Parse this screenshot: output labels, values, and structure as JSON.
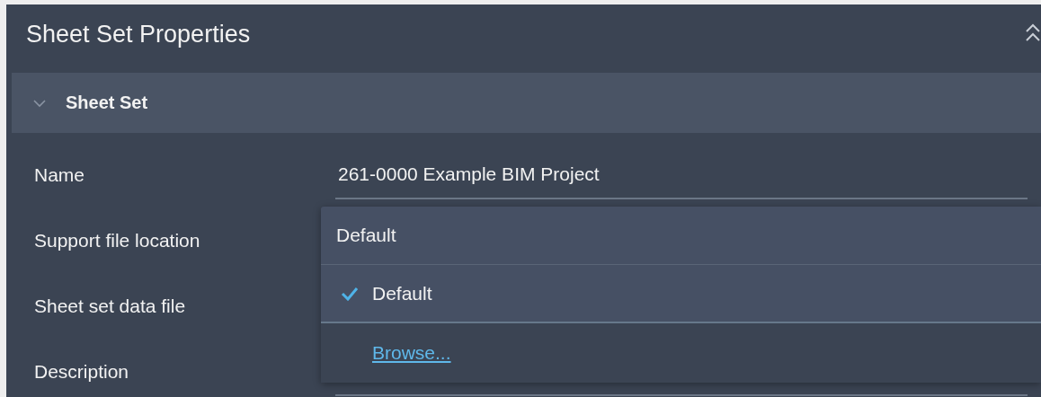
{
  "panel": {
    "title": "Sheet Set Properties"
  },
  "section": {
    "title": "Sheet Set",
    "expanded": true
  },
  "properties": [
    {
      "label": "Name",
      "value": "261-0000 Example BIM Project"
    },
    {
      "label": "Support file location",
      "field": false
    },
    {
      "label": "Sheet set data file",
      "field": false
    },
    {
      "label": "Description",
      "field": true
    }
  ],
  "dropdown": {
    "current": "Default",
    "options": [
      {
        "kind": "option",
        "label": "Default",
        "selected": true
      },
      {
        "kind": "link",
        "label": "Browse..."
      }
    ]
  }
}
